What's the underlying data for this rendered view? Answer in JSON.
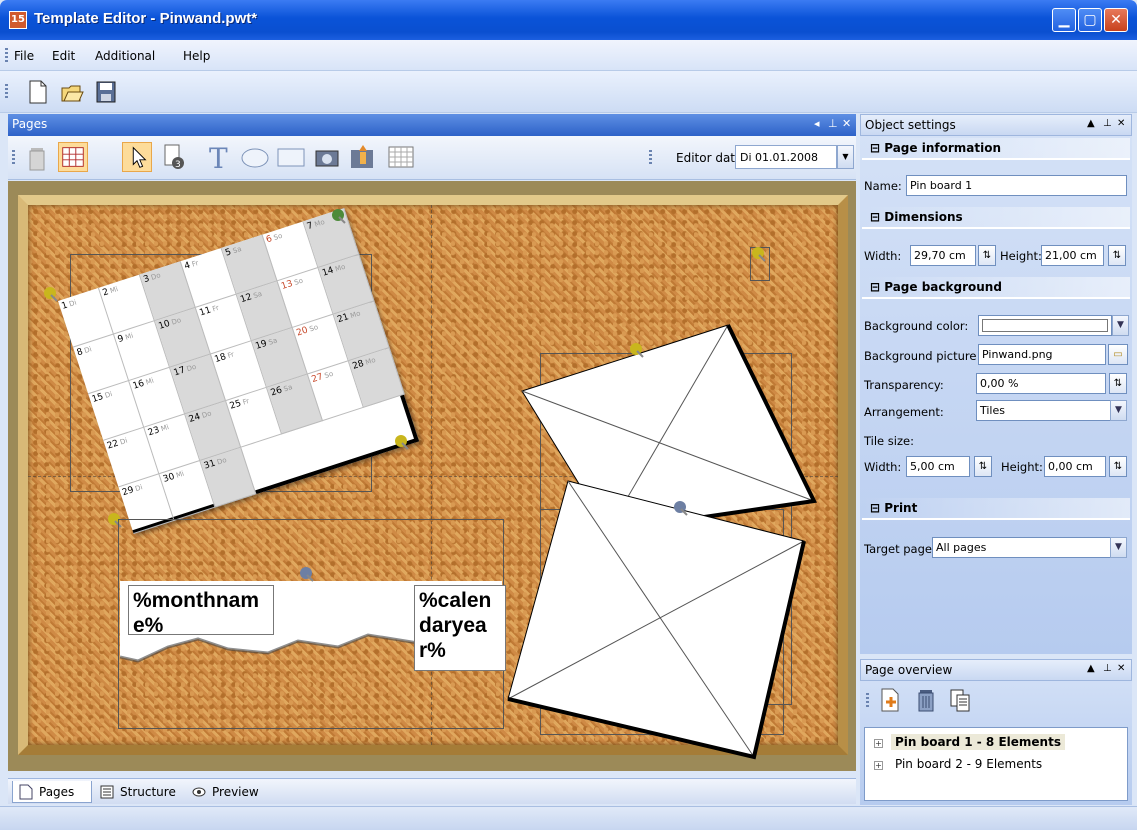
{
  "window": {
    "title": "Template Editor - Pinwand.pwt*",
    "app_icon_text": "15"
  },
  "menu": [
    "File",
    "Edit",
    "Additional",
    "Help"
  ],
  "toolbar": {
    "icons": [
      "new-document-icon",
      "open-folder-icon",
      "save-icon"
    ]
  },
  "pages_panel": {
    "title": "Pages",
    "header_controls": [
      "◂",
      "⊥",
      "✕"
    ],
    "tools": [
      "delete-icon",
      "grid-icon",
      "select-arrow-icon",
      "calendar-tool-icon",
      "text-tool-icon",
      "ellipse-tool-icon",
      "rectangle-tool-icon",
      "photo-tool-icon",
      "clipart-tool-icon",
      "table-tool-icon"
    ],
    "editor_date_label": "Editor date:",
    "editor_date_value": "Di 01.01.2008",
    "canvas": {
      "calendar_cells": [
        {
          "n": "1",
          "wd": "Di"
        },
        {
          "n": "2",
          "wd": "Mi"
        },
        {
          "n": "3",
          "wd": "Do"
        },
        {
          "n": "4",
          "wd": "Fr"
        },
        {
          "n": "5",
          "wd": "Sa"
        },
        {
          "n": "6",
          "wd": "So",
          "red": true
        },
        {
          "n": "7",
          "wd": "Mo"
        },
        {
          "n": "8",
          "wd": "Di"
        },
        {
          "n": "9",
          "wd": "Mi"
        },
        {
          "n": "10",
          "wd": "Do"
        },
        {
          "n": "11",
          "wd": "Fr"
        },
        {
          "n": "12",
          "wd": "Sa"
        },
        {
          "n": "13",
          "wd": "So",
          "red": true
        },
        {
          "n": "14",
          "wd": "Mo"
        },
        {
          "n": "15",
          "wd": "Di"
        },
        {
          "n": "16",
          "wd": "Mi"
        },
        {
          "n": "17",
          "wd": "Do"
        },
        {
          "n": "18",
          "wd": "Fr"
        },
        {
          "n": "19",
          "wd": "Sa"
        },
        {
          "n": "20",
          "wd": "So",
          "red": true
        },
        {
          "n": "21",
          "wd": "Mo"
        },
        {
          "n": "22",
          "wd": "Di"
        },
        {
          "n": "23",
          "wd": "Mi"
        },
        {
          "n": "24",
          "wd": "Do"
        },
        {
          "n": "25",
          "wd": "Fr"
        },
        {
          "n": "26",
          "wd": "Sa"
        },
        {
          "n": "27",
          "wd": "So",
          "red": true
        },
        {
          "n": "28",
          "wd": "Mo"
        },
        {
          "n": "29",
          "wd": "Di"
        },
        {
          "n": "30",
          "wd": "Mi"
        },
        {
          "n": "31",
          "wd": "Do"
        }
      ],
      "placeholder_month": "%monthname%",
      "placeholder_year": "%calendaryear%"
    }
  },
  "bottom_tabs": [
    "Pages",
    "Structure",
    "Preview"
  ],
  "object_settings": {
    "title": "Object settings",
    "header_controls": [
      "▲",
      "⊥",
      "✕"
    ],
    "page_information": {
      "title": "Page information",
      "name_label": "Name:",
      "name_value": "Pin board 1"
    },
    "dimensions": {
      "title": "Dimensions",
      "width_label": "Width:",
      "width_value": "29,70 cm",
      "height_label": "Height:",
      "height_value": "21,00 cm"
    },
    "page_background": {
      "title": "Page background",
      "bg_color_label": "Background color:",
      "bg_picture_label": "Background picture",
      "bg_picture_value": "Pinwand.png",
      "transparency_label": "Transparency:",
      "transparency_value": "0,00 %",
      "arrangement_label": "Arrangement:",
      "arrangement_value": "Tiles",
      "tile_size_label": "Tile size:",
      "tile_width_label": "Width:",
      "tile_width_value": "5,00 cm",
      "tile_height_label": "Height:",
      "tile_height_value": "0,00 cm"
    },
    "print": {
      "title": "Print",
      "target_label": "Target page",
      "target_value": "All pages"
    }
  },
  "page_overview": {
    "title": "Page overview",
    "header_controls": [
      "▲",
      "⊥",
      "✕"
    ],
    "items": [
      {
        "label": "Pin board 1 - 8 Elements",
        "selected": true
      },
      {
        "label": "Pin board 2 - 9 Elements",
        "selected": false
      }
    ]
  },
  "colors": {
    "titlebar": "#0a53d8",
    "panel_header": "#2e62c8",
    "cork": "#d59a52",
    "frame": "#d8b977"
  }
}
